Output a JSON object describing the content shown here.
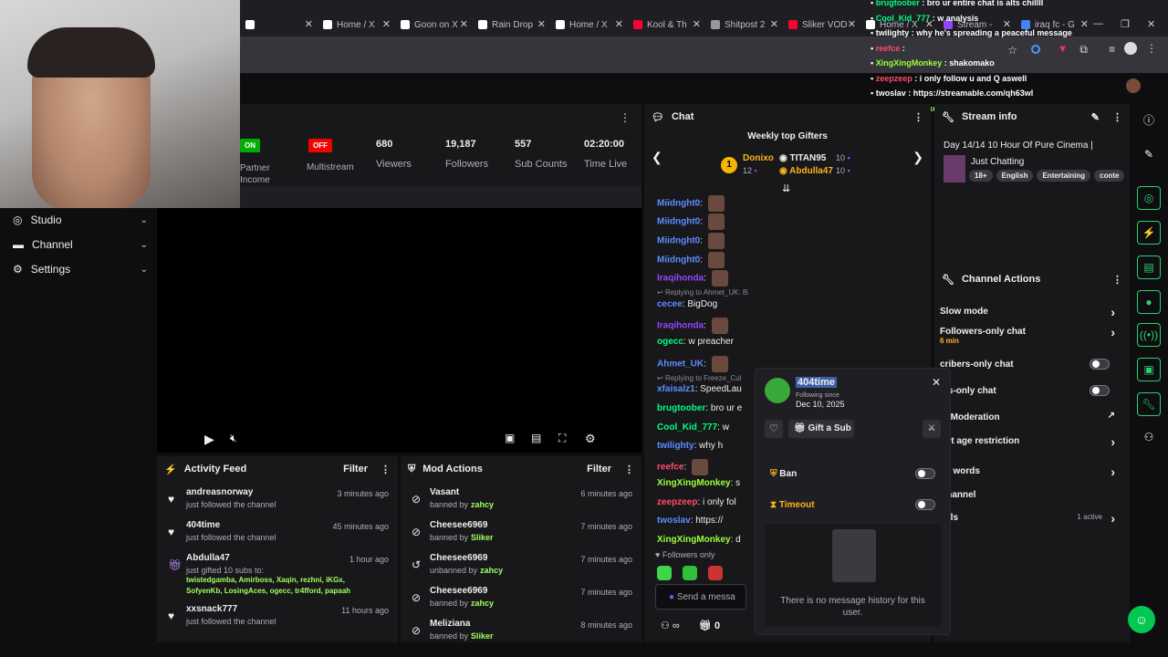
{
  "colors": {
    "accent": "#9147ff",
    "green": "#00ff7f",
    "live_red": "#eb0400",
    "on_green": "#00ad03"
  },
  "browser": {
    "tabs": [
      {
        "label": "",
        "icon": "x-logo"
      },
      {
        "label": "Home / X",
        "icon": "x-logo"
      },
      {
        "label": "Goon on X",
        "icon": "x-logo"
      },
      {
        "label": "Rain Drop",
        "icon": "x-logo"
      },
      {
        "label": "Home / X",
        "icon": "x-logo"
      },
      {
        "label": "Kool & Th",
        "icon": "youtube-logo"
      },
      {
        "label": "Shitpost 2",
        "icon": "globe"
      },
      {
        "label": "Sliker VOD",
        "icon": "youtube-logo"
      },
      {
        "label": "Home / X",
        "icon": "x-logo"
      },
      {
        "label": "Stream -",
        "icon": "twitch-logo"
      },
      {
        "label": "iraq fc - G",
        "icon": "google-logo"
      }
    ]
  },
  "overlay_chat": [
    {
      "user": "brugtoober",
      "msg": "bro ur entire chat is alts chillll",
      "color": "#00ff7f"
    },
    {
      "user": "Cool_Kid_777",
      "msg": "w analysis",
      "color": "#00ff7f"
    },
    {
      "user": "twilighty",
      "msg": "why he's spreading a peaceful message",
      "color": "#ffffff"
    },
    {
      "user": "reefce",
      "msg": "",
      "color": "#ff4d6a"
    },
    {
      "user": "XingXingMonkey",
      "msg": "shakomako",
      "color": "#9aff3b"
    },
    {
      "user": "zeepzeep",
      "msg": "i only follow u and Q aswell",
      "color": "#ff4d6a"
    },
    {
      "user": "twoslav",
      "msg": "https://streamable.com/qh63wl",
      "color": "#ffffff"
    },
    {
      "user": "XingXingMonkey",
      "msg": "deffo a hate watcher",
      "color": "#9aff3b"
    }
  ],
  "stats": {
    "on_label": "ON",
    "partner_label": "Partner",
    "income_label": "Income",
    "off_label": "OFF",
    "multistream_label": "Multistream",
    "viewers_value": "680",
    "viewers_label": "Viewers",
    "followers_value": "19,187",
    "followers_label": "Followers",
    "subs_value": "557",
    "subs_label": "Sub Counts",
    "time_value": "02:20:00",
    "time_label": "Time Live"
  },
  "left_nav": [
    {
      "label": "Studio",
      "icon": "studio-icon"
    },
    {
      "label": "Channel",
      "icon": "channel-icon"
    },
    {
      "label": "Settings",
      "icon": "gear-icon"
    }
  ],
  "activity": {
    "title": "Activity Feed",
    "filter": "Filter",
    "items": [
      {
        "name": "andreasnorway",
        "sub": "just followed the channel",
        "time": "3 minutes ago"
      },
      {
        "name": "404time",
        "sub": "just followed the channel",
        "time": "45 minutes ago"
      },
      {
        "name": "Abdulla47",
        "sub": "just gifted 10 subs to:",
        "time": "1 hour ago",
        "recipients": "twistedgamba, Amirboss, Xaqin, rezhni, iKGx, SofyenKb, LosingAces, ogecc, tr4fford, papaah"
      },
      {
        "name": "xxsnack777",
        "sub": "just followed the channel",
        "time": "11 hours ago"
      }
    ]
  },
  "mod": {
    "title": "Mod Actions",
    "filter": "Filter",
    "items": [
      {
        "name": "Vasant",
        "action": "banned by",
        "by": "zahcy",
        "time": "6 minutes ago"
      },
      {
        "name": "Cheesee6969",
        "action": "banned by",
        "by": "Sliker",
        "time": "7 minutes ago"
      },
      {
        "name": "Cheesee6969",
        "action": "unbanned by",
        "by": "zahcy",
        "time": "7 minutes ago"
      },
      {
        "name": "Cheesee6969",
        "action": "banned by",
        "by": "zahcy",
        "time": "7 minutes ago"
      },
      {
        "name": "Meliziana",
        "action": "banned by",
        "by": "Sliker",
        "time": "8 minutes ago"
      }
    ]
  },
  "chat": {
    "title": "Chat",
    "gifters_title": "Weekly top Gifters",
    "gifters": [
      {
        "rank": "1",
        "name": "Donixo",
        "count": "12"
      },
      {
        "name": "TITAN95",
        "count": "10"
      },
      {
        "name": "Abdulla47",
        "count": "10"
      }
    ],
    "lines": [
      {
        "user": "Miidnght0",
        "text": "",
        "color": "#5c8dff"
      },
      {
        "user": "Miidnght0",
        "text": "",
        "color": "#5c8dff"
      },
      {
        "user": "Miidnght0",
        "text": "",
        "color": "#5c8dff"
      },
      {
        "user": "Miidnght0",
        "text": "",
        "color": "#5c8dff"
      },
      {
        "user": "Iraqihonda",
        "text": "",
        "color": "#9147ff"
      },
      {
        "reply": "Replying to Ahmet_UK: BigDog"
      },
      {
        "user": "cecee",
        "text": "BigDog",
        "color": "#5c8dff"
      },
      {
        "user": "Iraqihonda",
        "text": "",
        "color": "#9147ff"
      },
      {
        "user": "ogecc",
        "text": "w preacher",
        "color": "#00ff7f"
      },
      {
        "user": "Ahmet_UK",
        "text": "",
        "color": "#5c8dff"
      },
      {
        "reply": "Replying to Freeze_Cul"
      },
      {
        "user": "xfaisalz1",
        "text": "SpeedLau",
        "color": "#5c8dff"
      },
      {
        "user": "brugtoober",
        "text": "bro ur e",
        "color": "#00ff7f"
      },
      {
        "user": "Cool_Kid_777",
        "text": "w",
        "color": "#00ff7f"
      },
      {
        "user": "twilighty",
        "text": "why h",
        "color": "#5c8dff"
      },
      {
        "user": "reefce",
        "text": "",
        "color": "#ff4d6a"
      },
      {
        "user": "XingXingMonkey",
        "text": "s",
        "color": "#9aff3b"
      },
      {
        "user": "zeepzeep",
        "text": "i only fol",
        "color": "#ff4d6a"
      },
      {
        "user": "twoslav",
        "text": "https://",
        "color": "#5c8dff"
      },
      {
        "user": "XingXingMonkey",
        "text": "d",
        "color": "#9aff3b"
      }
    ],
    "followers_only": "Followers only",
    "send_placeholder": "Send a messa",
    "count": "0"
  },
  "stream_info": {
    "title": "Stream info",
    "stream_title": "Day 14/14 10 Hour Of Pure Cinema |",
    "category": "Just Chatting",
    "tags": [
      "18+",
      "English",
      "Entertaining",
      "conte"
    ]
  },
  "channel_actions": {
    "title": "Channel Actions",
    "items": [
      {
        "label": "Slow mode",
        "kind": "arrow"
      },
      {
        "label": "Followers-only chat",
        "kind": "arrow",
        "sub": "6 min"
      },
      {
        "label": "cribers-only chat",
        "kind": "toggle"
      },
      {
        "label": "tes-only chat",
        "kind": "toggle"
      },
      {
        "label": "at Moderation",
        "kind": "link"
      },
      {
        "label": "unt age restriction",
        "kind": "arrow"
      },
      {
        "label": "ed words",
        "kind": "arrow"
      },
      {
        "label": "Channel",
        "kind": "none"
      },
      {
        "label": "oals",
        "kind": "arrow",
        "extra": "1 active"
      }
    ]
  },
  "user_card": {
    "username": "404time",
    "following_since_label": "Following since",
    "following_since": "Dec 10, 2025",
    "gift_label": "Gift a Sub",
    "ban_label": "Ban",
    "timeout_label": "Timeout",
    "no_history": "There is no message history for this user."
  }
}
